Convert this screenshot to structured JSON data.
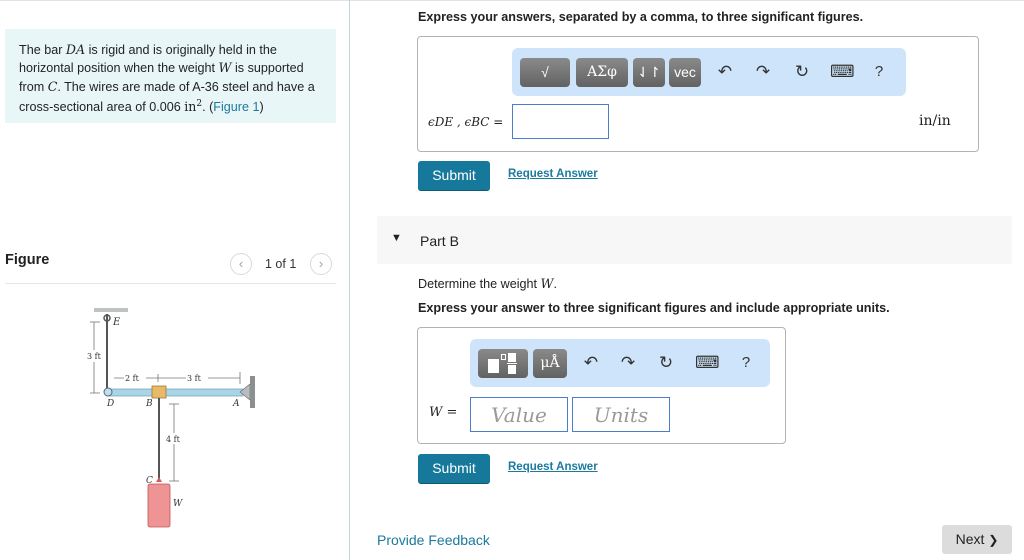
{
  "problem": {
    "text_parts": [
      "The bar ",
      "DA",
      " is rigid and is originally held in the horizontal position when the weight ",
      "W",
      " is supported from ",
      "C",
      ". The wires are made of A-36 steel and have a cross-sectional area of 0.006 ",
      "in",
      "2",
      ". ("
    ],
    "figure_link": "Figure 1",
    "close_paren": ")"
  },
  "figure_panel": {
    "title": "Figure",
    "pager": "1 of 1",
    "prev_icon": "‹",
    "next_icon": "›",
    "labels": {
      "E": "E",
      "D": "D",
      "B": "B",
      "A": "A",
      "C": "C",
      "W": "W",
      "dim_3ft_vertical": "3 ft",
      "dim_2ft": "2 ft",
      "dim_3ft_horizontal": "3 ft",
      "dim_4ft": "4 ft"
    }
  },
  "part_a": {
    "instruction": "Express your answers, separated by a comma, to three significant figures.",
    "toolbar": {
      "templates_label": "√",
      "greek_label": "ΑΣφ",
      "arrows_label": "⇃↾",
      "vec_label": "vec",
      "undo_icon": "↶",
      "redo_icon": "↷",
      "reset_icon": "↻",
      "keyboard_icon": "⌨",
      "help_label": "?"
    },
    "input_label": "ϵDE , ϵBC =",
    "input_value": "",
    "unit": "in/in",
    "submit_label": "Submit",
    "request_label": "Request Answer"
  },
  "part_b": {
    "title": "Part B",
    "question_prefix": "Determine the weight ",
    "question_var": "W",
    "question_suffix": ".",
    "instruction": "Express your answer to three significant figures and include appropriate units.",
    "toolbar": {
      "unit_label": "μÅ",
      "undo_icon": "↶",
      "redo_icon": "↷",
      "reset_icon": "↻",
      "keyboard_icon": "⌨",
      "help_label": "?"
    },
    "input_label": "W =",
    "value_placeholder": "Value",
    "units_placeholder": "Units",
    "submit_label": "Submit",
    "request_label": "Request Answer"
  },
  "footer": {
    "feedback_label": "Provide Feedback",
    "next_label": "Next",
    "next_icon": "❯"
  },
  "colors": {
    "accent": "#16789a",
    "link": "#1b7a9d",
    "problem_bg": "#e8f6f8",
    "toolbar_bg": "#cde4fa",
    "input_border": "#4b7dcc"
  }
}
